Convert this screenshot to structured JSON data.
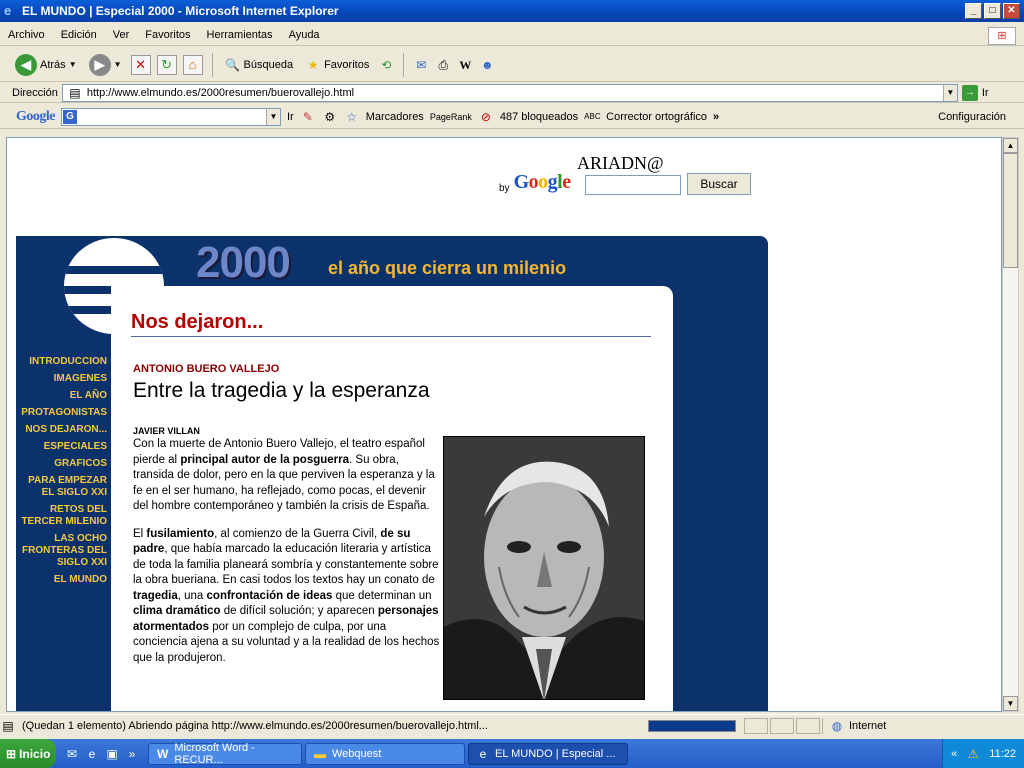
{
  "window": {
    "title": "EL MUNDO | Especial 2000 - Microsoft Internet Explorer"
  },
  "menu": [
    "Archivo",
    "Edición",
    "Ver",
    "Favoritos",
    "Herramientas",
    "Ayuda"
  ],
  "toolbar": {
    "back": "Atrás",
    "search": "Búsqueda",
    "favorites": "Favoritos"
  },
  "address": {
    "label": "Dirección",
    "url": "http://www.elmundo.es/2000resumen/buerovallejo.html",
    "go": "Ir"
  },
  "googlebar": {
    "logo": "Google",
    "go": "Ir",
    "bookmarks": "Marcadores",
    "pagerank": "PageRank",
    "blocked": "487 bloqueados",
    "spell": "Corrector ortográfico",
    "settings": "Configuración"
  },
  "page": {
    "ariadna": "ARIADN@",
    "by": "by",
    "google": "Google",
    "search_button": "Buscar",
    "logo_year": "2000",
    "tagline": "el año que cierra un milenio",
    "section_title": "Nos dejaron...",
    "nav": [
      "INTRODUCCION",
      "IMAGENES",
      "EL AÑO",
      "PROTAGONISTAS",
      "NOS DEJARON...",
      "ESPECIALES",
      "GRAFICOS",
      "PARA EMPEZAR EL SIGLO XXI",
      "RETOS DEL TERCER MILENIO",
      "LAS OCHO FRONTERAS DEL SIGLO XXI",
      "EL MUNDO"
    ],
    "subject": "ANTONIO BUERO VALLEJO",
    "headline": "Entre la tragedia y la esperanza",
    "byline": "JAVIER VILLAN",
    "p1": {
      "a": "Con la muerte de Antonio Buero Vallejo, el teatro español pierde al ",
      "b": "principal autor de la posguerra",
      "c": ". Su obra, transida de dolor, pero en la que perviven la esperanza y la fe en el ser humano, ha reflejado, como pocas, el devenir del hombre contemporáneo y también la crisis de España."
    },
    "p2": {
      "a": "El ",
      "b": "fusilamiento",
      "c": ", al comienzo de la Guerra Civil, ",
      "d": "de su padre",
      "e": ", que había marcado la educación literaria y artística de toda la familia planeará sombría y constantemente sobre la obra bueriana. En casi todos los textos hay un conato de ",
      "f": "tragedia",
      "g": ", una ",
      "h": "confrontación de ideas",
      "i": " que determinan un ",
      "j": "clima dramático",
      "k": " de difícil solución; y aparecen ",
      "l": "personajes atormentados",
      "m": " por un complejo de culpa, por una conciencia ajena a su voluntad y a la realidad de los hechos que la produjeron."
    }
  },
  "status": {
    "text": "(Quedan 1 elemento) Abriendo página http://www.elmundo.es/2000resumen/buerovallejo.html...",
    "zone": "Internet",
    "progress": 0.35
  },
  "taskbar": {
    "start": "Inicio",
    "tasks": [
      "Microsoft Word - RECUR...",
      "Webquest",
      "EL MUNDO | Especial ..."
    ],
    "clock": "11:22"
  }
}
